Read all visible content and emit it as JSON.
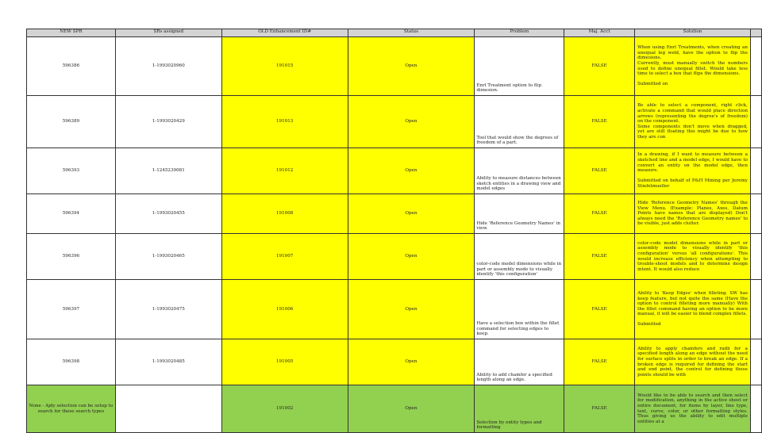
{
  "colors": {
    "yellow": "#ffff00",
    "green": "#92d050",
    "header": "#d4d4d4"
  },
  "columns": [
    "NEW SPR",
    "SRs assigned",
    "OLD Enhancement ID#",
    "Status",
    "Problem",
    "Maj. Acct",
    "Solution"
  ],
  "rows": [
    {
      "spr": "596386",
      "sr": "1-1993020960",
      "old_id": "191015",
      "status": "Open",
      "problem": "Enrl Treatment option to flip dimesion.",
      "maj": "FALSE",
      "solution": "When using Enrl Treatments, when creating an unequal leg weld, have the option to flip the dimesions.\nCurrently, must manually switch the numbers used to define unequal fillet. Would take less time to select a box that flips the dimensions.\n\nSubmitted on"
    },
    {
      "spr": "596389",
      "sr": "1-1993020429",
      "old_id": "191013",
      "status": "Open",
      "problem": "Tool that would show the degrees of freedom of a part.",
      "maj": "FALSE",
      "solution": "Be able to select a component, right click, activate a command that would place direction arrows (representing the degree's of freedom) on the component.\nSome components don't move when dragged, yet are still floating this might be due to how they are con"
    },
    {
      "spr": "596393",
      "sr": "1-1245239081",
      "old_id": "191012",
      "status": "Open",
      "problem": "Ability to measure distances between sketch entities in a drawing view and model edges",
      "maj": "FALSE",
      "solution": "In a drawing, if I want to measure between a sketched line and a model edge, I would have to convert an entity on the model edge, then measure.\n\nSubmitted on behalf of P&H Mining per Jeremy Stiefelmueller"
    },
    {
      "spr": "596394",
      "sr": "1-1993020455",
      "old_id": "191008",
      "status": "Open",
      "problem": "Hide 'Reference Geometry Names' in view.",
      "maj": "FALSE",
      "solution": "Hide 'Reference Geometry Names' through the View Menu. (Example: Planes, Axes, Datum Points have names that are displayed) Don't always need the 'Reference Geometry names' to be visible, just adds clutter."
    },
    {
      "spr": "596396",
      "sr": "1-1993020465",
      "old_id": "191007",
      "status": "Open",
      "problem": "color-code model dimensions while in part or assembly mode to visually identify 'this configuration'",
      "maj": "FALSE",
      "solution": "color-code model dimensions while in part or assembly mode to visually identify 'this configuration' versus 'all configurations'. This would increase efficiency when attempting to trouble-shoot models and to determine design intent. It would also reduce"
    },
    {
      "spr": "596397",
      "sr": "1-1993020475",
      "old_id": "191006",
      "status": "Open",
      "problem": "Have a selection box within the fillet command for selecting edges to keep.",
      "maj": "FALSE",
      "solution": "Ability to 'Keep Edges' when filleting. SW has keep feature, but not quite the same (Have the option to control filleting more manually) With the fillet command having an option to be more manual, it will be easier to blend complex fillets.\n\nSubmitted"
    },
    {
      "spr": "596398",
      "sr": "1-1993020485",
      "old_id": "191005",
      "status": "Open",
      "problem": "Ability to add chamfer a specified length along an edge.",
      "maj": "FALSE",
      "solution": "Ability to apply chamfers and radii for a specified length along an edge without the need for surface splits in order to break an edge. If a broken edge is required for defining the start and end point, the control for defining these points should be with"
    },
    {
      "spr": "None - Ajdy selection can be setup to search for these search types",
      "sr": "",
      "old_id": "191002",
      "status": "Open",
      "problem": "Selection by entity types and formatting",
      "maj": "FALSE",
      "solution": "Would like to be able to search and then select for modification, anything in the active sheet or entire document, for items by layer, line type, text, curve, color, or other formatting styles. Thus giving us the ability to edit multiple entities at a"
    }
  ]
}
